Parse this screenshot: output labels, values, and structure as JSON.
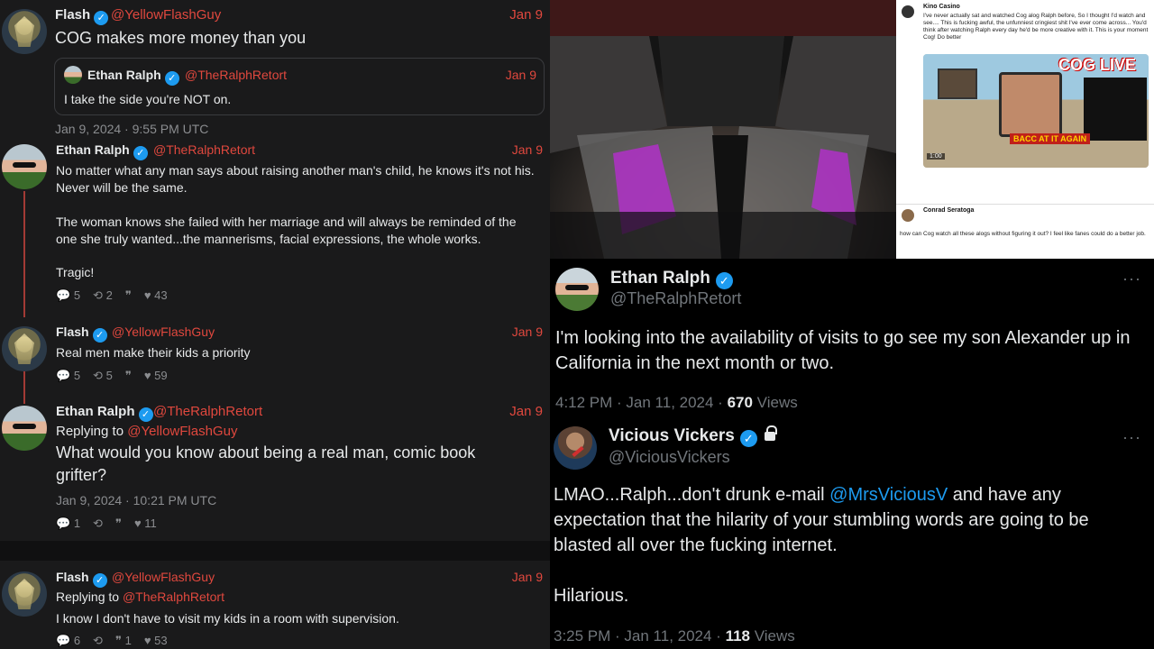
{
  "left": {
    "posts": [
      {
        "author": "Flash",
        "handle": "@YellowFlashGuy",
        "date": "Jan 9",
        "text": "COG makes more money than you",
        "timestamp": "Jan 9, 2024 · 9:55 PM UTC",
        "quote": {
          "author": "Ethan Ralph",
          "handle": "@TheRalphRetort",
          "date": "Jan 9",
          "text": "I take the side you're NOT on."
        }
      },
      {
        "author": "Ethan Ralph",
        "handle": "@TheRalphRetort",
        "date": "Jan 9",
        "paragraphs": [
          "No matter what any man says about raising another man's child, he knows it's not his. Never will be the same.",
          "The woman knows she failed with her marriage and will always be reminded of the one she truly wanted...the mannerisms, facial expressions, the whole works.",
          "Tragic!"
        ],
        "stats": {
          "replies": "5",
          "retweets": "2",
          "quotes": "",
          "likes": "43"
        }
      },
      {
        "author": "Flash",
        "handle": "@YellowFlashGuy",
        "date": "Jan 9",
        "text": "Real men make their kids a priority",
        "stats": {
          "replies": "5",
          "retweets": "5",
          "quotes": "",
          "likes": "59"
        }
      },
      {
        "author": "Ethan Ralph",
        "handle": "@TheRalphRetort",
        "date": "Jan 9",
        "replying_prefix": "Replying to",
        "replying_to": "@YellowFlashGuy",
        "text": "What would you know about being a real man, comic book grifter?",
        "timestamp": "Jan 9, 2024 · 10:21 PM UTC",
        "stats": {
          "replies": "1",
          "retweets": "",
          "quotes": "",
          "likes": "11"
        }
      },
      {
        "author": "Flash",
        "handle": "@YellowFlashGuy",
        "date": "Jan 9",
        "replying_prefix": "Replying to",
        "replying_to": "@TheRalphRetort",
        "text": "I know I don't have to visit my kids in a room with supervision.",
        "stats": {
          "replies": "6",
          "retweets": "",
          "quotes": "1",
          "likes": "53"
        }
      }
    ]
  },
  "card": {
    "author": "Kino Casino",
    "text": "I've never actually sat and watched Cog alog Ralph before, So I thought I'd watch and see.... This is fucking awful, the unfunniest cringiest shit I've ever come across... You'd think after watching Ralph every day he'd be more creative with it. This is your moment Cog! Do better",
    "video_logo": "COG LIVE",
    "video_banner": "BACC AT IT AGAIN",
    "video_time": "1:00",
    "reply_author": "Conrad Seratoga",
    "reply_text": "how can Cog watch all these alogs without figuring it out? I feel like fanes could do a better job."
  },
  "right": {
    "tweet1": {
      "name": "Ethan Ralph",
      "handle": "@TheRalphRetort",
      "text": "I'm looking into the availability of visits to go see my son Alexander up in California in the next month or two.",
      "time": "4:12 PM · Jan 11, 2024 · ",
      "views_count": "670",
      "views_label": " Views",
      "more": "···"
    },
    "tweet2": {
      "name": "Vicious Vickers",
      "handle": "@ViciousVickers",
      "text_pre": "LMAO...Ralph...don't drunk e-mail ",
      "mention": "@MrsViciousV",
      "text_post": " and have any expectation that the hilarity of your stumbling words are going to be blasted all over the fucking internet.",
      "text2": "Hilarious.",
      "time": "3:25 PM · Jan 11, 2024 · ",
      "views_count": "118",
      "views_label": " Views",
      "more": "···"
    }
  },
  "icons": {
    "verified": "✓",
    "reply": "💬",
    "retweet": "⟲",
    "quote": "❞",
    "like": "♥"
  },
  "colors": {
    "handle_red": "#e0483e",
    "verified_blue": "#1d9bf0",
    "left_bg": "#1a1a1b"
  }
}
